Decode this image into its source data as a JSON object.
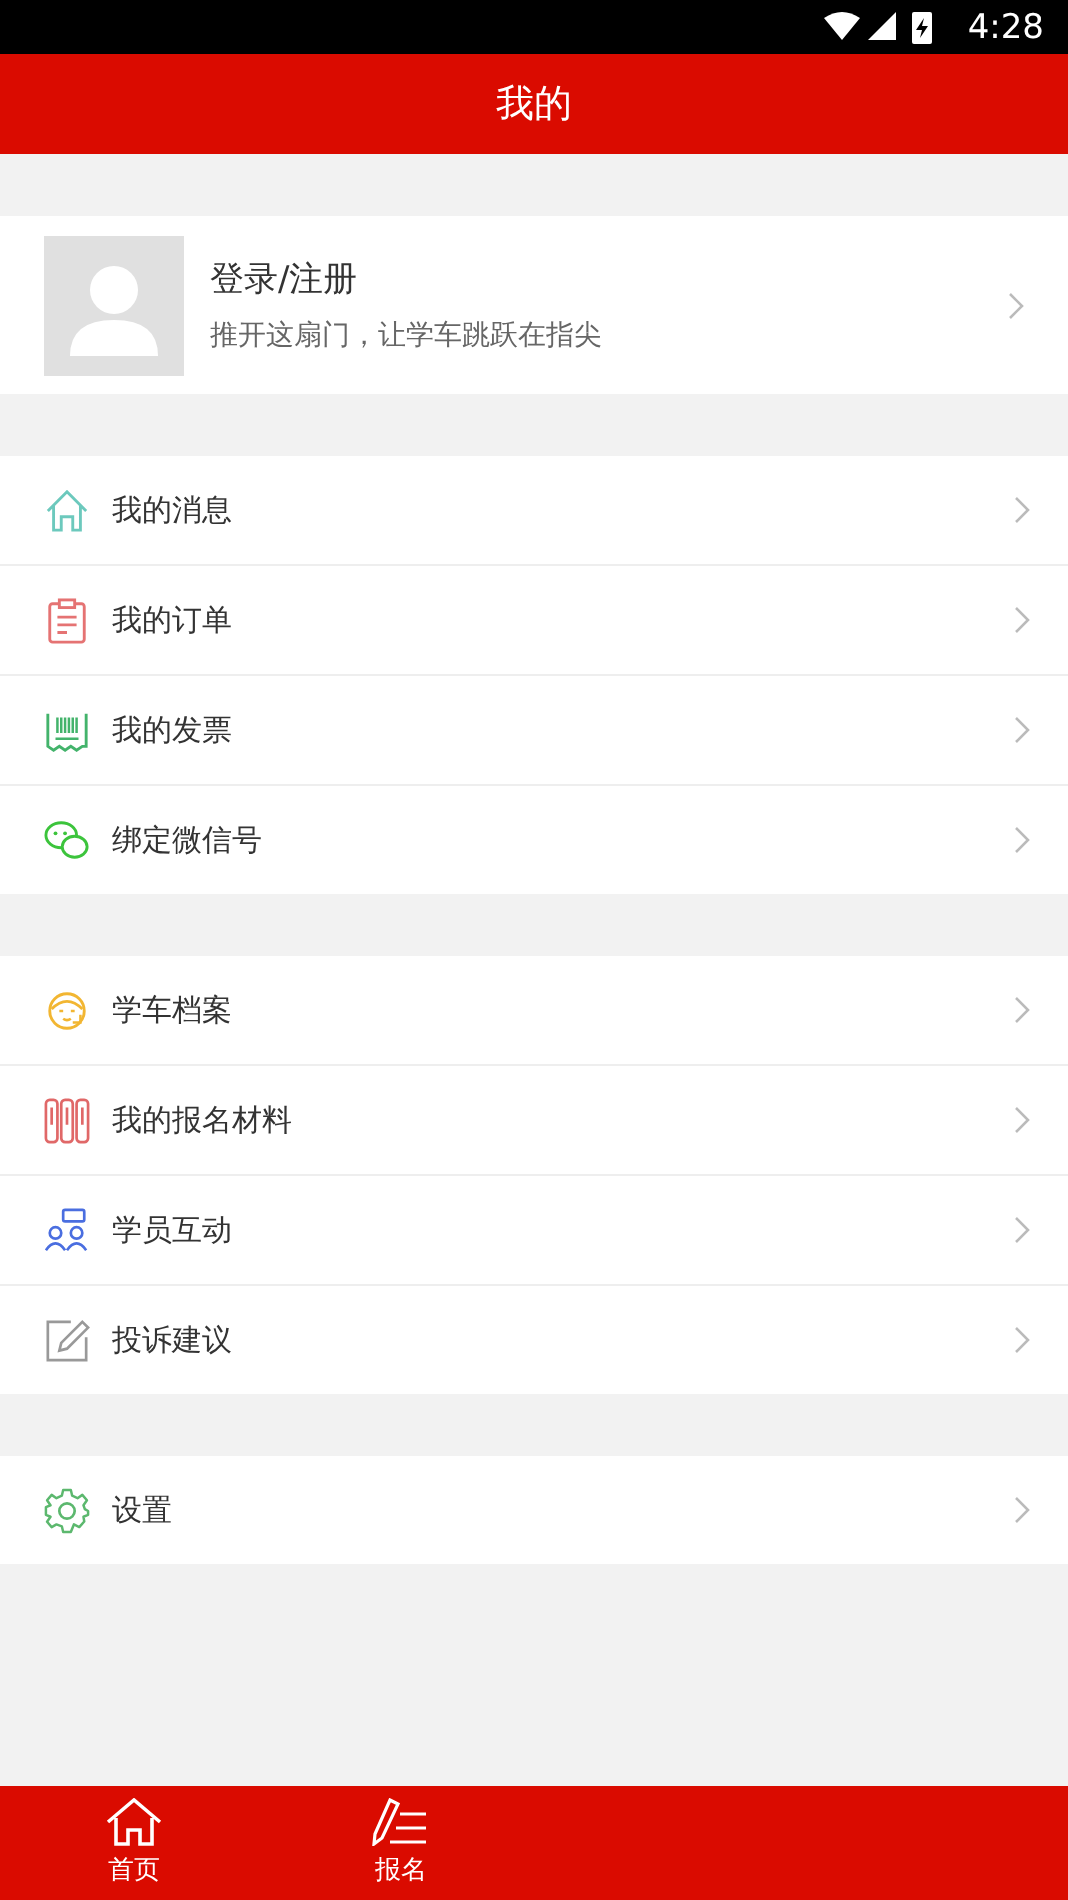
{
  "status_bar": {
    "time": "4:28"
  },
  "header": {
    "title": "我的"
  },
  "profile": {
    "name": "登录/注册",
    "subtitle": "推开这扇门，让学车跳跃在指尖"
  },
  "groups": [
    {
      "items": [
        {
          "kind": "home",
          "label": "我的消息"
        },
        {
          "kind": "clipboard",
          "label": "我的订单"
        },
        {
          "kind": "receipt",
          "label": "我的发票"
        },
        {
          "kind": "wechat",
          "label": "绑定微信号"
        }
      ]
    },
    {
      "items": [
        {
          "kind": "agent",
          "label": "学车档案"
        },
        {
          "kind": "binders",
          "label": "我的报名材料"
        },
        {
          "kind": "people",
          "label": "学员互动"
        },
        {
          "kind": "edit",
          "label": "投诉建议"
        }
      ]
    },
    {
      "items": [
        {
          "kind": "gear",
          "label": "设置"
        }
      ]
    }
  ],
  "bottom_nav": [
    {
      "kind": "home",
      "label": "首页"
    },
    {
      "kind": "pen",
      "label": "报名"
    }
  ]
}
